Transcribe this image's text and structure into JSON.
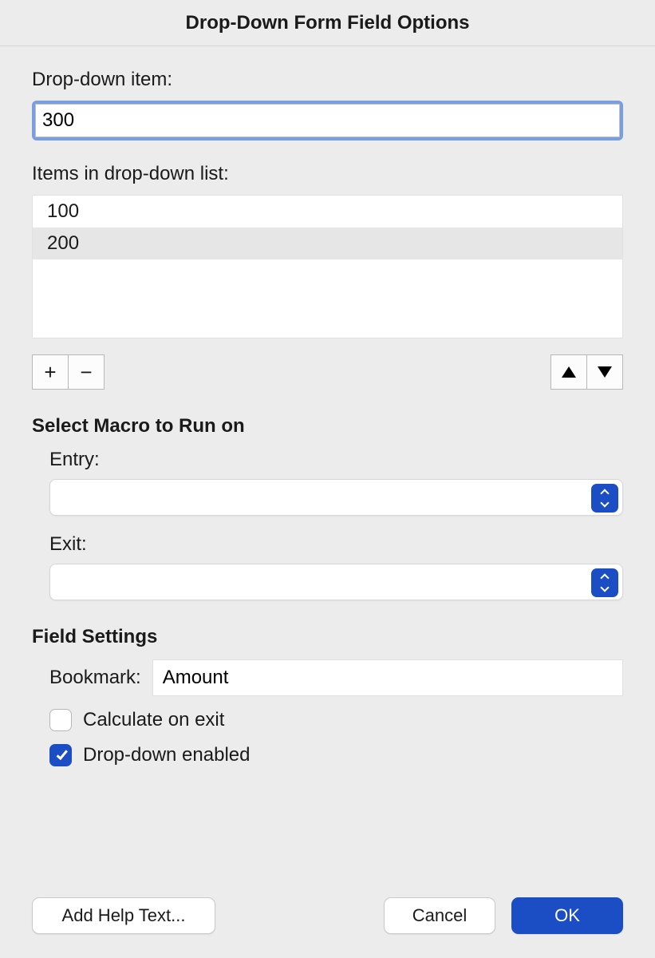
{
  "title": "Drop-Down Form Field Options",
  "dropdown_item": {
    "label": "Drop-down item:",
    "value": "300"
  },
  "items_in_list": {
    "label": "Items in drop-down list:",
    "items": [
      "100",
      "200"
    ]
  },
  "macro_section": {
    "heading": "Select Macro to Run on",
    "entry_label": "Entry:",
    "entry_value": "",
    "exit_label": "Exit:",
    "exit_value": ""
  },
  "field_settings": {
    "heading": "Field Settings",
    "bookmark_label": "Bookmark:",
    "bookmark_value": "Amount",
    "calculate_label": "Calculate on exit",
    "calculate_checked": false,
    "enabled_label": "Drop-down enabled",
    "enabled_checked": true
  },
  "buttons": {
    "add_help": "Add Help Text...",
    "cancel": "Cancel",
    "ok": "OK"
  }
}
